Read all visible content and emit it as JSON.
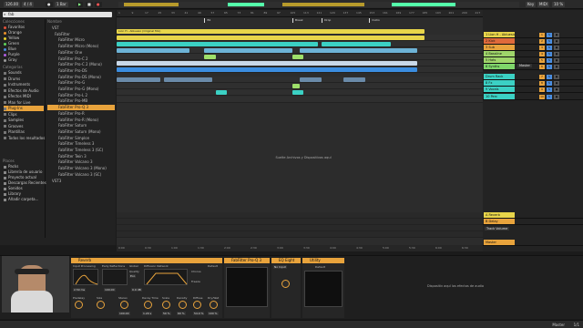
{
  "topbar": {
    "tempo": "126.00",
    "signature": "4 / 4",
    "bar": "1 Bar",
    "position": "33. 1. 1",
    "end_position": "4. 0. 0",
    "key": "Key",
    "midi": "MIDI",
    "cpu": "10 %"
  },
  "browser": {
    "search": "fab",
    "collections_header": "Colecciones",
    "collections": [
      {
        "label": "Favoritos",
        "color": "#e0513b"
      },
      {
        "label": "Orange",
        "color": "#e8902b"
      },
      {
        "label": "Yellow",
        "color": "#e8d02b"
      },
      {
        "label": "Green",
        "color": "#5fd35b"
      },
      {
        "label": "Blue",
        "color": "#4a8be0"
      },
      {
        "label": "Purple",
        "color": "#b05fe0"
      },
      {
        "label": "Gray",
        "color": "#9a9a9a"
      }
    ],
    "categories_header": "Categorías",
    "categories": [
      "Sounds",
      "Drums",
      "Instruments",
      "Efectos de Audio",
      "Efectos MIDI",
      "Max for Live",
      "Plug-Ins",
      "Clips",
      "Samples",
      "Grooves",
      "Plantillas",
      "Todos los resultados"
    ],
    "selected_category": "Plug-Ins",
    "places_header": "Places",
    "places": [
      "Packs",
      "Librería de usuario",
      "Proyecto actual",
      "Descargas Recientes",
      "Sonidos",
      "Library",
      "Añadir carpeta..."
    ],
    "name_header": "Nombre",
    "files": [
      "VST",
      "FabFilter",
      "FabFilter Micro",
      "FabFilter Micro (Mono)",
      "FabFilter One",
      "FabFilter Pro-C 2",
      "FabFilter Pro-C 2 (Mono)",
      "FabFilter Pro-DS",
      "FabFilter Pro-DS (Mono)",
      "FabFilter Pro-G",
      "FabFilter Pro-G (Mono)",
      "FabFilter Pro-L 2",
      "FabFilter Pro-MB",
      "FabFilter Pro-Q 3",
      "FabFilter Pro-R",
      "FabFilter Pro-R (Mono)",
      "FabFilter Saturn",
      "FabFilter Saturn (Mono)",
      "FabFilter Simplon",
      "FabFilter Timeless 3",
      "FabFilter Timeless 3 (SC)",
      "FabFilter Twin 3",
      "FabFilter Volcano 3",
      "FabFilter Volcano 3 (Mono)",
      "FabFilter Volcano 3 (SC)",
      "VST3"
    ],
    "selected_file": "FabFilter Pro-Q 3"
  },
  "arrangement": {
    "ruler": [
      "1",
      "9",
      "17",
      "25",
      "33",
      "41",
      "49",
      "57",
      "65",
      "73",
      "81",
      "89",
      "97",
      "105",
      "113",
      "121",
      "129",
      "137",
      "145",
      "153",
      "161",
      "169",
      "177",
      "185",
      "193",
      "201",
      "209",
      "217"
    ],
    "markers": [
      {
        "label": "B1",
        "pos": 0.24
      },
      {
        "label": "Break",
        "pos": 0.48
      },
      {
        "label": "Drop",
        "pos": 0.56
      },
      {
        "label": "Outro",
        "pos": 0.69
      }
    ],
    "lead_clip": "Lion H - Abluesio (Original Mix)",
    "drop_message": "Suelte Archivos y Dispositivos aquí",
    "time_ruler": [
      "0:00",
      "0:30",
      "1:00",
      "1:30",
      "2:00",
      "2:30",
      "3:00",
      "3:30",
      "4:00",
      "4:30",
      "5:00",
      "5:30",
      "6:00",
      "6:30"
    ]
  },
  "mixer": {
    "tracks": [
      {
        "name": "1 Lion H - Abluesio (Original Mix)",
        "color": "#e8d54a",
        "num": "1"
      },
      {
        "name": "2 Kick",
        "color": "#e06a3b",
        "num": "2"
      },
      {
        "name": "3 Sub",
        "color": "#e8a33c",
        "num": "3"
      },
      {
        "name": "4 Bassline",
        "color": "#9fd66a",
        "num": "4"
      },
      {
        "name": "5 Hats",
        "color": "#9fd66a",
        "num": "5"
      },
      {
        "name": "6 Synths",
        "color": "#7fd66a",
        "num": "6"
      },
      {
        "name": "Drum Rack",
        "color": "#3bd1c4",
        "num": "7"
      },
      {
        "name": "8 Fx",
        "color": "#3bd1c4",
        "num": "8"
      },
      {
        "name": "9 Vocals",
        "color": "#3bd1c4",
        "num": "9"
      },
      {
        "name": "10 Perc",
        "color": "#3bd1c4",
        "num": "10"
      }
    ],
    "returns": [
      {
        "name": "A Reverb",
        "color": "#e8d54a"
      },
      {
        "name": "B Delay",
        "color": "#e8a33c"
      }
    ],
    "master": {
      "name": "Master",
      "color": "#e8a33c"
    },
    "routing": "Master",
    "track_volume": "Track Volume"
  },
  "devices": {
    "reverb": {
      "title": "Reverb",
      "input_processing": "Input Processing",
      "early_reflections": "Early Reflections",
      "global": "Global",
      "diffusion_network": "Diffusion Network",
      "chorus": "Chorus",
      "freeze": "Freeze",
      "predelay_label": "Predelay",
      "predelay": "2.50 ms",
      "size_label": "Size",
      "size": "100.00",
      "decay_label": "Decay Time",
      "decay": "1.20 s",
      "stereo_label": "Stereo",
      "stereo": "100.00",
      "density_label": "Density",
      "density": "60 %",
      "scale_label": "Scale",
      "scale": "50 %",
      "diffuse_label": "Diffuse",
      "diffuse": "54.0 %",
      "dry_wet_label": "Dry/Wet",
      "dry_wet": "100 %",
      "quality": "Eco",
      "quality_label": "Quality",
      "reflect_label": "Reflect",
      "reflect": "0.0 dB",
      "default_label": "Default"
    },
    "plugin2": {
      "title": "FabFilter Pro-Q 3"
    },
    "plugin3": {
      "title": "EQ Eight"
    },
    "plugin4": {
      "title": "Utility",
      "default_label": "Default",
      "no_input": "No Input"
    },
    "drop_message": "Dispositiv aquí los efectos de audio"
  },
  "statusbar": {
    "right_label": "Master",
    "right_value": "1/1"
  }
}
